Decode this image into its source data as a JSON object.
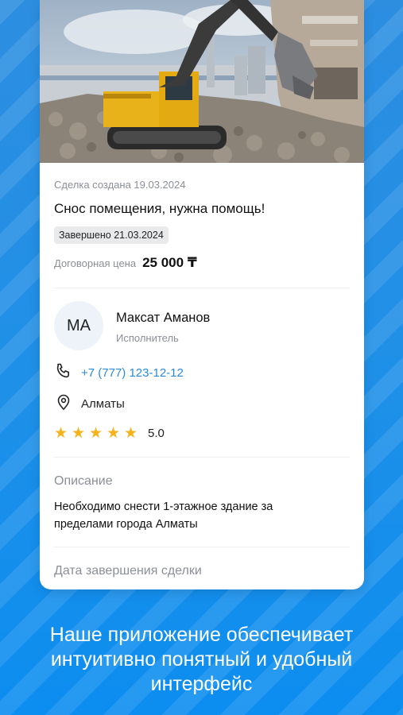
{
  "deal": {
    "created": "Сделка создана 19.03.2024",
    "title": "Снос помещения, нужна помощь!",
    "status_badge": "Завершено 21.03.2024",
    "price_label": "Договорная цена",
    "price_value": "25 000 ₸"
  },
  "performer": {
    "initials": "МА",
    "name": "Максат Аманов",
    "role": "Исполнитель",
    "phone": "+7 (777) 123-12-12",
    "city": "Алматы",
    "rating": "5.0",
    "stars": 5
  },
  "description": {
    "title": "Описание",
    "text": "Необходимо снести 1-этажное здание за пределами города Алматы"
  },
  "completion": {
    "title": "Дата завершения сделки"
  },
  "tagline": {
    "line1": "Наше приложение обеспечивает",
    "line2": "интуитивно понятный и удобный",
    "line3": "интерфейс"
  },
  "colors": {
    "accent": "#2a8ad9",
    "star": "#f6b21b",
    "background": "#1e90e8"
  },
  "icons": [
    "phone-icon",
    "location-pin-icon",
    "star-icon"
  ]
}
